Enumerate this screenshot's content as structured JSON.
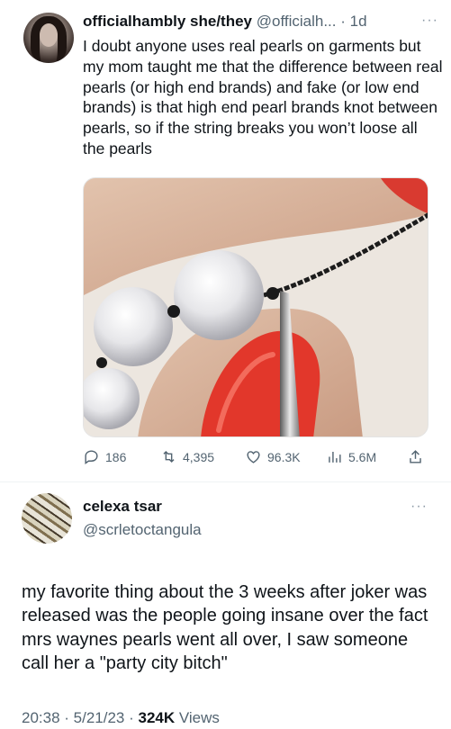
{
  "tweet1": {
    "author_name": "officialhambly she/they",
    "handle": "@officialh...",
    "separator": " · ",
    "time": "1d",
    "text": "I doubt anyone uses real pearls on garments but my mom taught me that the difference between real pearls (or high end brands) and fake (or low end brands) is that high end pearl brands knot between pearls, so if the string breaks you won’t loose all the pearls",
    "actions": {
      "replies": "186",
      "retweets": "4,395",
      "likes": "96.3K",
      "views": "5.6M"
    },
    "icons": [
      "reply-icon",
      "retweet-icon",
      "like-icon",
      "views-icon",
      "share-icon",
      "more-icon"
    ]
  },
  "tweet2": {
    "author_name": "celexa tsar",
    "handle": "@scrletoctangula",
    "text": "my favorite thing about the 3 weeks after joker was released was the people going insane over the fact mrs waynes pearls went all over, I saw someone call her a \"party city bitch\"",
    "time": "20:38",
    "date": "5/21/23",
    "views_count": "324K",
    "views_label": "Views",
    "dot": " · "
  },
  "colors": {
    "text": "#0f1419",
    "muted": "#536471",
    "nail": "#e2372b",
    "divider": "#eff3f4"
  }
}
